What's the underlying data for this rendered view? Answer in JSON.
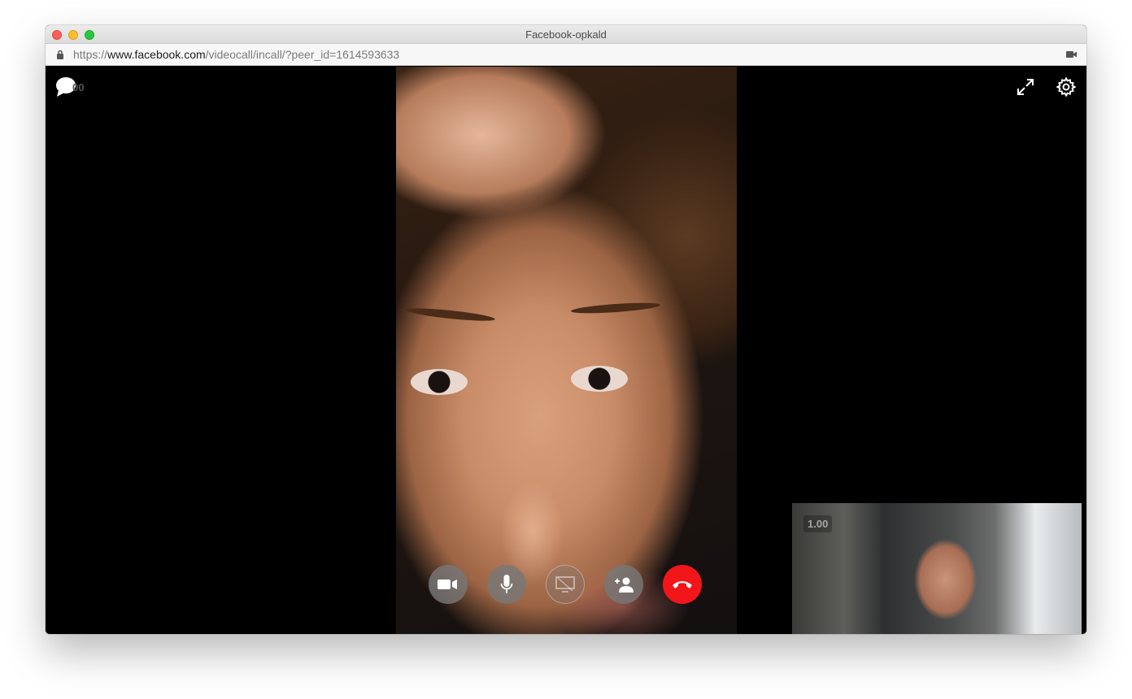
{
  "window": {
    "title": "Facebook-opkald"
  },
  "address_bar": {
    "scheme": "https://",
    "host": "www.facebook.com",
    "path": "/videocall/incall/?peer_id=1614593633"
  },
  "call": {
    "chat_count": "00",
    "local_preview_label": "1.00",
    "controls": [
      {
        "name": "camera-toggle",
        "icon": "video-camera-icon",
        "state": "active"
      },
      {
        "name": "microphone-toggle",
        "icon": "microphone-icon",
        "state": "active"
      },
      {
        "name": "screen-share",
        "icon": "screen-share-icon",
        "state": "disabled"
      },
      {
        "name": "add-person",
        "icon": "add-person-icon",
        "state": "active"
      },
      {
        "name": "end-call",
        "icon": "hang-up-icon",
        "state": "active"
      }
    ]
  },
  "colors": {
    "end_call": "#f2161b",
    "control_bg": "#787878",
    "stage_bg": "#000000"
  }
}
